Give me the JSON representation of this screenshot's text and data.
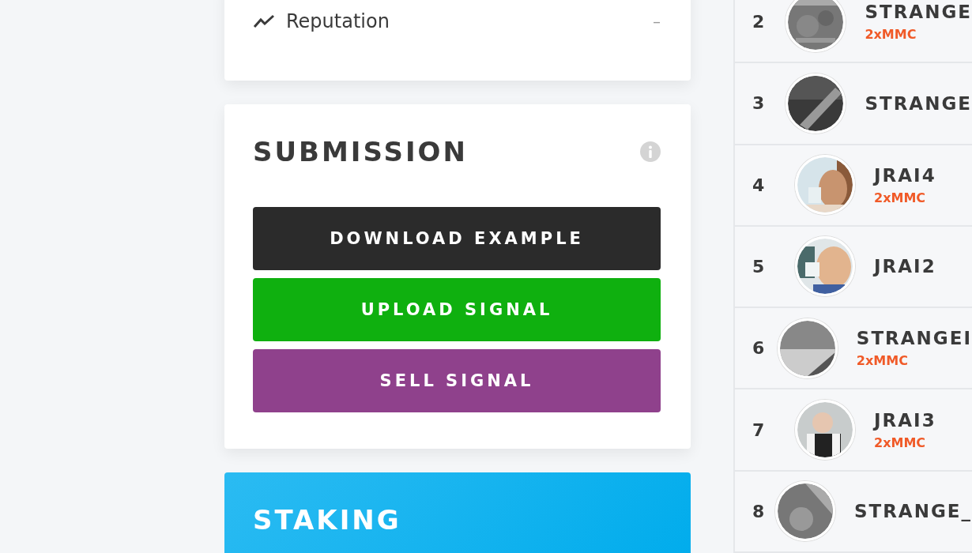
{
  "reputation": {
    "label": "Reputation",
    "value": "–"
  },
  "submission": {
    "title": "SUBMISSION",
    "buttons": [
      {
        "label": "DOWNLOAD EXAMPLE",
        "kind": "download"
      },
      {
        "label": "UPLOAD SIGNAL",
        "kind": "upload"
      },
      {
        "label": "SELL SIGNAL",
        "kind": "sell"
      }
    ]
  },
  "staking": {
    "title": "STAKING"
  },
  "leaderboard": [
    {
      "rank": "2",
      "name": "STRANGE",
      "badge": "2xMMC"
    },
    {
      "rank": "3",
      "name": "STRANGE"
    },
    {
      "rank": "4",
      "name": "JRAI4",
      "badge": "2xMMC"
    },
    {
      "rank": "5",
      "name": "JRAI2"
    },
    {
      "rank": "6",
      "name": "STRANGEI",
      "badge": "2xMMC"
    },
    {
      "rank": "7",
      "name": "JRAI3",
      "badge": "2xMMC"
    },
    {
      "rank": "8",
      "name": "STRANGE_"
    }
  ]
}
